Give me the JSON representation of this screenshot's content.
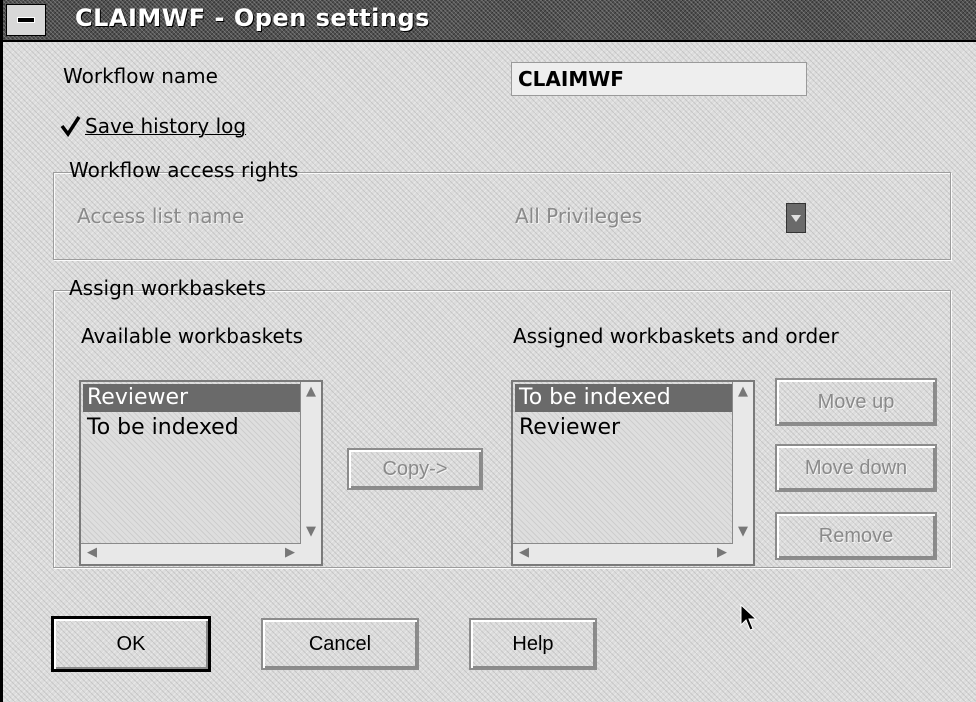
{
  "window": {
    "title": "CLAIMWF - Open settings"
  },
  "workflow_name": {
    "label": "Workflow name",
    "value": "CLAIMWF"
  },
  "save_history": {
    "label": "Save history log",
    "checked": true
  },
  "access_rights": {
    "group_label": "Workflow access rights",
    "list_label": "Access list name",
    "selected_value": "All Privileges"
  },
  "workbaskets": {
    "group_label": "Assign workbaskets",
    "available": {
      "heading": "Available workbaskets",
      "items": [
        "Reviewer",
        "To be indexed"
      ],
      "selected_index": 0
    },
    "assigned": {
      "heading": "Assigned workbaskets and order",
      "items": [
        "To be indexed",
        "Reviewer"
      ],
      "selected_index": 0
    },
    "copy_label": "Copy->",
    "move_up_label": "Move up",
    "move_down_label": "Move down",
    "remove_label": "Remove"
  },
  "buttons": {
    "ok": "OK",
    "cancel": "Cancel",
    "help": "Help"
  },
  "icons": {
    "system_menu": "system-menu-icon",
    "check": "checkmark-icon",
    "dropdown": "dropdown-arrow-icon",
    "pointer": "mouse-pointer-icon"
  }
}
